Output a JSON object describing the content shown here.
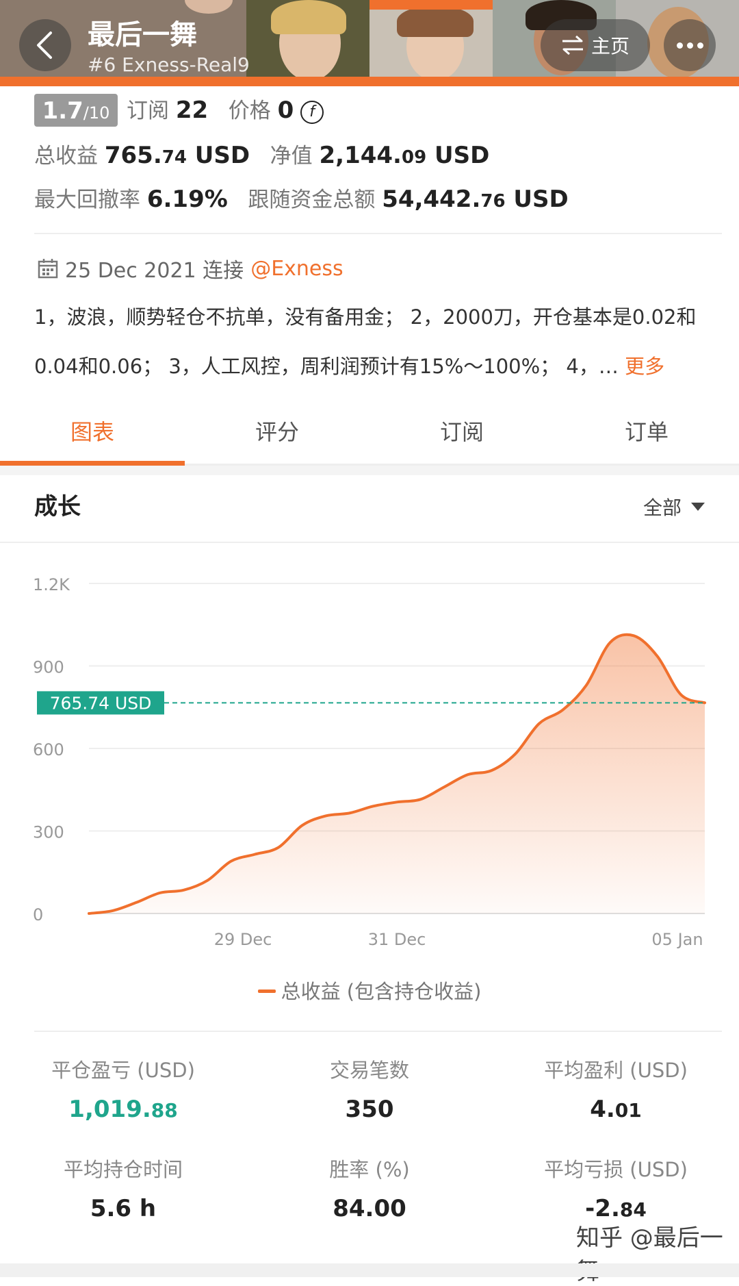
{
  "header": {
    "title": "最后一舞",
    "subtitle": "#6  Exness-Real9",
    "home_label": "主页"
  },
  "stats": {
    "rating": "1.7",
    "rating_max": "/10",
    "subscribe_label": "订阅",
    "subscribe_count": "22",
    "price_label": "价格",
    "price_value": "0",
    "total_profit_label": "总收益",
    "total_profit_int": "765.",
    "total_profit_dec": "74",
    "total_profit_unit": " USD",
    "equity_label": "净值",
    "equity_int": "2,144.",
    "equity_dec": "09",
    "equity_unit": " USD",
    "drawdown_label": "最大回撤率",
    "drawdown_value": "6.19%",
    "follow_label": "跟随资金总额",
    "follow_int": "54,442.",
    "follow_dec": "76",
    "follow_unit": " USD"
  },
  "info": {
    "date_text": "25 Dec 2021 连接",
    "broker_handle": "@Exness",
    "desc_line1": "1，波浪，顺势轻仓不抗单，没有备用金； 2，2000刀，开仓基本是0.02和",
    "desc_line2": "0.04和0.06； 3，人工风控，周利润预计有15%～100%； 4，…",
    "more_label": "更多"
  },
  "tabs": [
    {
      "label": "图表",
      "active": true
    },
    {
      "label": "评分",
      "active": false
    },
    {
      "label": "订阅",
      "active": false
    },
    {
      "label": "订单",
      "active": false
    }
  ],
  "growth": {
    "title": "成长",
    "range_label": "全部"
  },
  "chart_data": {
    "type": "area",
    "y_ticks": [
      "1.2K",
      "900",
      "600",
      "300",
      "0"
    ],
    "y_tick_values": [
      1200,
      900,
      600,
      300,
      0
    ],
    "x_ticks": [
      "29 Dec",
      "31 Dec",
      "05 Jan"
    ],
    "ylim": [
      0,
      1200
    ],
    "series": [
      {
        "name": "总收益 (包含持仓收益)",
        "color": "#f0702d",
        "values": [
          0,
          10,
          40,
          75,
          85,
          120,
          190,
          215,
          240,
          320,
          355,
          365,
          390,
          405,
          415,
          460,
          505,
          520,
          580,
          690,
          740,
          830,
          985,
          1010,
          935,
          795,
          766
        ]
      }
    ],
    "current_marker": {
      "label": "765.74 USD",
      "value": 765.74,
      "color": "#1fa58c"
    }
  },
  "metrics": [
    {
      "label": "平仓盈亏 (USD)",
      "int": "1,019.",
      "dec": "88",
      "green": true
    },
    {
      "label": "交易笔数",
      "int": "350",
      "dec": "",
      "green": false
    },
    {
      "label": "平均盈利 (USD)",
      "int": "4.",
      "dec": "01",
      "green": false
    },
    {
      "label": "平均持仓时间",
      "int": "5.6 h",
      "dec": "",
      "green": false
    },
    {
      "label": "胜率 (%)",
      "int": "84.00",
      "dec": "",
      "green": false
    },
    {
      "label": "平均亏损 (USD)",
      "int": "-2.",
      "dec": "84",
      "green": false
    }
  ],
  "watermark": "知乎 @最后一舞"
}
